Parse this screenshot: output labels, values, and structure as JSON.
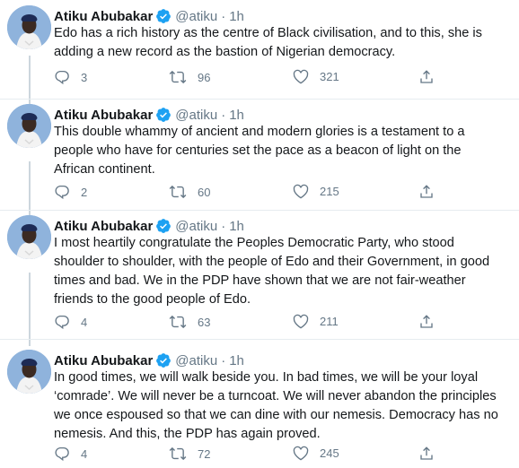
{
  "tweets": [
    {
      "author": "Atiku Abubakar",
      "handle": "@atiku",
      "separator": "·",
      "time": "1h",
      "text": "Edo has a rich history as the centre of Black civilisation, and to this, she is\nadding a new record as the bastion of Nigerian democracy.",
      "replies": "3",
      "retweets": "96",
      "likes": "321"
    },
    {
      "author": "Atiku Abubakar",
      "handle": "@atiku",
      "separator": "·",
      "time": "1h",
      "text": "This double whammy of ancient and modern glories is a testament to a\npeople who have for centuries set the pace as a beacon of light on the\nAfrican continent.",
      "replies": "2",
      "retweets": "60",
      "likes": "215"
    },
    {
      "author": "Atiku Abubakar",
      "handle": "@atiku",
      "separator": "·",
      "time": "1h",
      "text": "I most heartily congratulate the Peoples Democratic Party, who stood\nshoulder to shoulder, with the people of Edo and their Government, in good\ntimes and bad. We in the PDP have shown that we are not fair-weather\nfriends to the good people of Edo.",
      "replies": "4",
      "retweets": "63",
      "likes": "211"
    },
    {
      "author": "Atiku Abubakar",
      "handle": "@atiku",
      "separator": "·",
      "time": "1h",
      "text": "In good times, we will walk beside you. In bad times, we will be your loyal\n‘comrade’. We will never be a turncoat. We will never abandon the principles\nwe once espoused so that we can dine with our nemesis. Democracy has no\nnemesis. And this, the PDP has again proved.",
      "replies": "4",
      "retweets": "72",
      "likes": "245"
    }
  ],
  "icons": {
    "reply": "reply-icon",
    "retweet": "retweet-icon",
    "like": "heart-icon",
    "share": "share-icon",
    "verified": "verified-badge-icon"
  },
  "colors": {
    "text": "#14171a",
    "secondary": "#657786",
    "verified": "#1da1f2",
    "thread_line": "#ccd6dd"
  }
}
